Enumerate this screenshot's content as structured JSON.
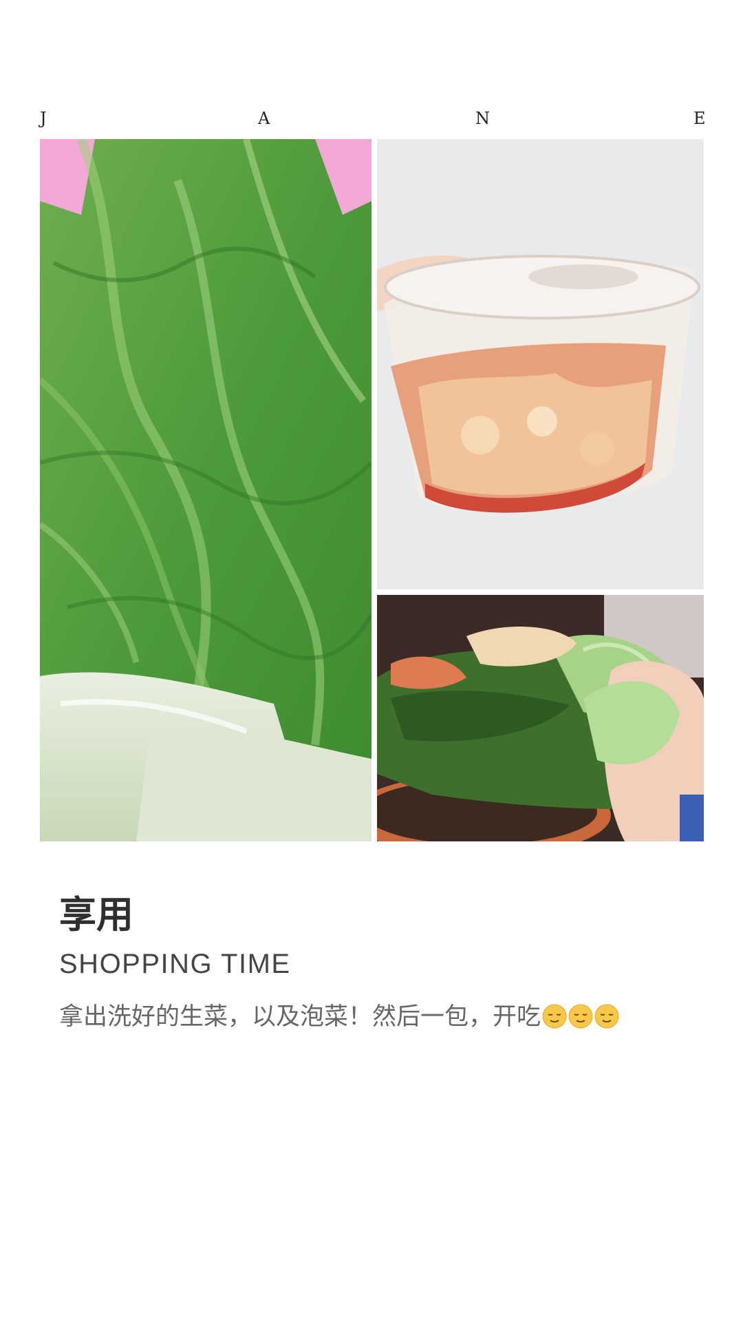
{
  "brand": {
    "letters": [
      "J",
      "A",
      "N",
      "E"
    ]
  },
  "collage": {
    "photos": [
      {
        "icon": "lettuce-photo"
      },
      {
        "icon": "kimchi-container-photo"
      },
      {
        "icon": "lettuce-wrap-photo"
      }
    ]
  },
  "content": {
    "title": "享用",
    "subtitle": "SHOPPING TIME",
    "description": "拿出洗好的生菜，以及泡菜！然后一包，开吃"
  },
  "emoji": {
    "name": "relieved-face-icon",
    "count": 3
  },
  "colors": {
    "background": "#ffffff",
    "title": "#2f2f2f",
    "subtitle": "#444444",
    "description": "#666666"
  }
}
